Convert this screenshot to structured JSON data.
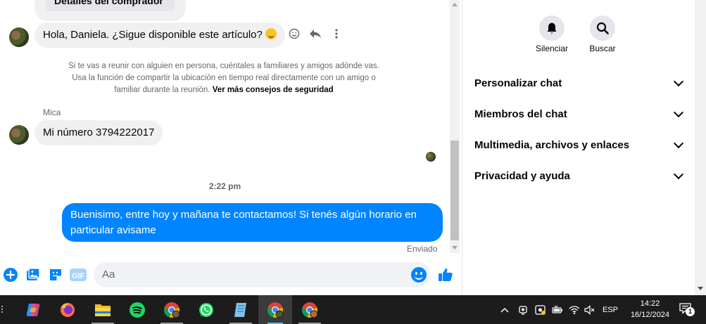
{
  "chat": {
    "buyer_card_label": "Detalles del comprador",
    "first_message": "Hola, Daniela. ¿Sigue disponible este artículo?",
    "safety_notice": "Si te vas a reunir con alguien en persona, cuéntales a familiares y amigos adónde vas. Usa la función de compartir la ubicación en tiempo real directamente con un amigo o familiar durante la reunión.",
    "safety_link": "Ver más consejos de seguridad",
    "sender_name": "Mica",
    "second_message": "Mi número 3794222017",
    "time_separator": "2:22 pm",
    "outgoing_message": "Buenisimo, entre hoy y mañana te contactamos! Si tenés algún horario en particular avisame",
    "status": "Enviado"
  },
  "composer": {
    "placeholder": "Aa",
    "gif_label": "GIF",
    "icons": [
      "plus-icon",
      "image-icon",
      "sticker-icon",
      "gif-icon",
      "emoji-icon",
      "like-icon"
    ]
  },
  "panel": {
    "mute_label": "Silenciar",
    "search_label": "Buscar",
    "sections": [
      {
        "label": "Personalizar chat"
      },
      {
        "label": "Miembros del chat"
      },
      {
        "label": "Multimedia, archivos y enlaces"
      },
      {
        "label": "Privacidad y ayuda"
      }
    ]
  },
  "taskbar": {
    "apps": [
      "copilot",
      "firefox",
      "file-explorer",
      "spotify",
      "chrome",
      "whatsapp",
      "notepad",
      "chrome",
      "chrome"
    ],
    "language": "ESP",
    "time": "14:22",
    "date": "16/12/2024",
    "notification_count": "1"
  },
  "colors": {
    "accent": "#0084ff",
    "incoming_bubble": "#f0f0f0",
    "taskbar": "#1c1c1c"
  }
}
